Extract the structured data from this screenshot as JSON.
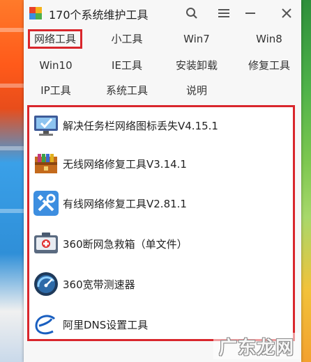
{
  "window": {
    "title": "170个系统维护工具",
    "search_icon": "search-icon",
    "menu_icon": "menu-icon",
    "close_icon": "close-icon"
  },
  "tabs": [
    {
      "label": "网络工具",
      "active": true
    },
    {
      "label": "小工具"
    },
    {
      "label": "Win7"
    },
    {
      "label": "Win8"
    },
    {
      "label": "Win10"
    },
    {
      "label": "IE工具"
    },
    {
      "label": "安装卸载"
    },
    {
      "label": "修复工具"
    },
    {
      "label": "IP工具"
    },
    {
      "label": "系统工具"
    },
    {
      "label": "说明"
    }
  ],
  "tools": [
    {
      "label": "解决任务栏网络图标丢失V4.15.1",
      "icon": "monitor-check-icon"
    },
    {
      "label": "无线网络修复工具V3.14.1",
      "icon": "archive-box-icon"
    },
    {
      "label": "有线网络修复工具V2.81.1",
      "icon": "wrench-screwdriver-icon"
    },
    {
      "label": "360断网急救箱（单文件）",
      "icon": "first-aid-kit-icon"
    },
    {
      "label": "360宽带测速器",
      "icon": "speedometer-icon"
    },
    {
      "label": "阿里DNS设置工具",
      "icon": "alibaba-e-icon"
    }
  ],
  "watermark": "广东龙网",
  "colors": {
    "highlight": "#d9262c",
    "window_bg": "#f7f7f7"
  }
}
